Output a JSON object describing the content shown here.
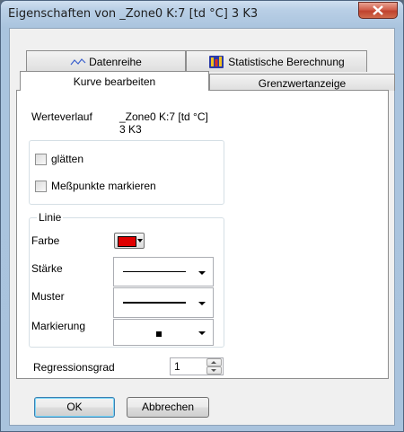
{
  "window": {
    "title": "Eigenschaften von _Zone0 K:7 [td °C] 3 K3"
  },
  "tabs": {
    "datenreihe": "Datenreihe",
    "statistik": "Statistische Berechnung",
    "kurve": "Kurve bearbeiten",
    "grenzwert": "Grenzwertanzeige"
  },
  "verlauf": {
    "label": "Werteverlauf",
    "value_line1": "_Zone0 K:7 [td °C]",
    "value_line2": "3 K3"
  },
  "options": {
    "smooth_label": "glätten",
    "smooth_checked": false,
    "mark_label": "Meßpunkte markieren",
    "mark_checked": false
  },
  "linie": {
    "legend": "Linie",
    "farbe_label": "Farbe",
    "farbe_color": "#e00000",
    "staerke_label": "Stärke",
    "muster_label": "Muster",
    "markierung_label": "Markierung"
  },
  "regression": {
    "label": "Regressionsgrad",
    "value": "1"
  },
  "buttons": {
    "ok": "OK",
    "cancel": "Abbrechen"
  }
}
